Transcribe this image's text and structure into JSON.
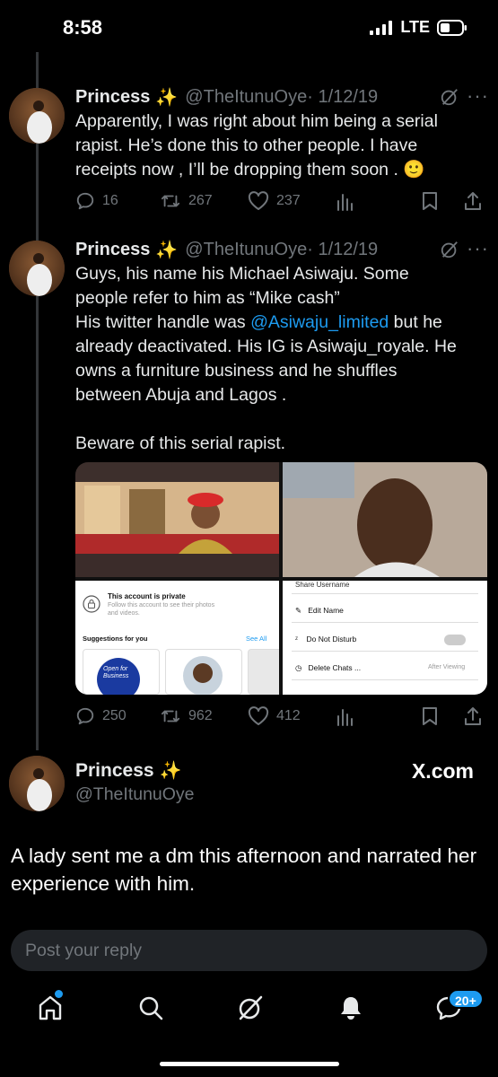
{
  "status_bar": {
    "time": "8:58",
    "network": "LTE"
  },
  "tweets": [
    {
      "name": "Princess",
      "sparkle": "✨",
      "handle": "@TheItunuOye",
      "date": "· 1/12/19",
      "text": "Apparently, I was right about him being a serial rapist. He’s done this to other people. I have receipts now , I’ll be dropping them soon . 🙂",
      "replies": "16",
      "reposts": "267",
      "likes": "237"
    },
    {
      "name": "Princess",
      "sparkle": "✨",
      "handle": "@TheItunuOye",
      "date": "· 1/12/19",
      "text_lines": [
        "Guys, his name his Michael Asiwaju. Some",
        "people refer to him as “Mike cash”"
      ],
      "text_line3_prefix": "His twitter handle was ",
      "text_mention": "@Asiwaju_limited",
      "text_line3_suffix": " but he",
      "text_lines_after": [
        "already deactivated. His IG is Asiwaju_royale. He",
        "owns a furniture business and he shuffles",
        "between Abuja and Lagos ."
      ],
      "text_beware": "Beware of this serial rapist.",
      "replies": "250",
      "reposts": "962",
      "likes": "412"
    }
  ],
  "media": {
    "left_private_title": "This account is private",
    "left_private_sub1": "Follow this account to see their photos",
    "left_private_sub2": "and videos.",
    "left_suggestions": "Suggestions for you",
    "left_see_all": "See All",
    "left_logo_text": "Open for Business",
    "right_share_username": "Share Username",
    "right_edit_name": "Edit Name",
    "right_dnd": "Do Not Disturb",
    "right_delete_chats": "Delete Chats ...",
    "right_after_viewing": "After Viewing"
  },
  "main_tweet": {
    "name": "Princess",
    "sparkle": "✨",
    "handle": "@TheItunuOye",
    "watermark": "X.com",
    "text": "A lady sent me a dm this afternoon and narrated her experience with him."
  },
  "reply": {
    "placeholder": "Post your reply"
  },
  "nav": {
    "messages_badge": "20+"
  },
  "colors": {
    "accent": "#1d9bf0",
    "background": "#000000",
    "secondary_text": "#71767b"
  },
  "icons": [
    "reply-icon",
    "repost-icon",
    "like-icon",
    "views-icon",
    "bookmark-icon",
    "share-icon",
    "grok-icon",
    "home-icon",
    "search-icon",
    "bell-icon",
    "messages-icon"
  ]
}
